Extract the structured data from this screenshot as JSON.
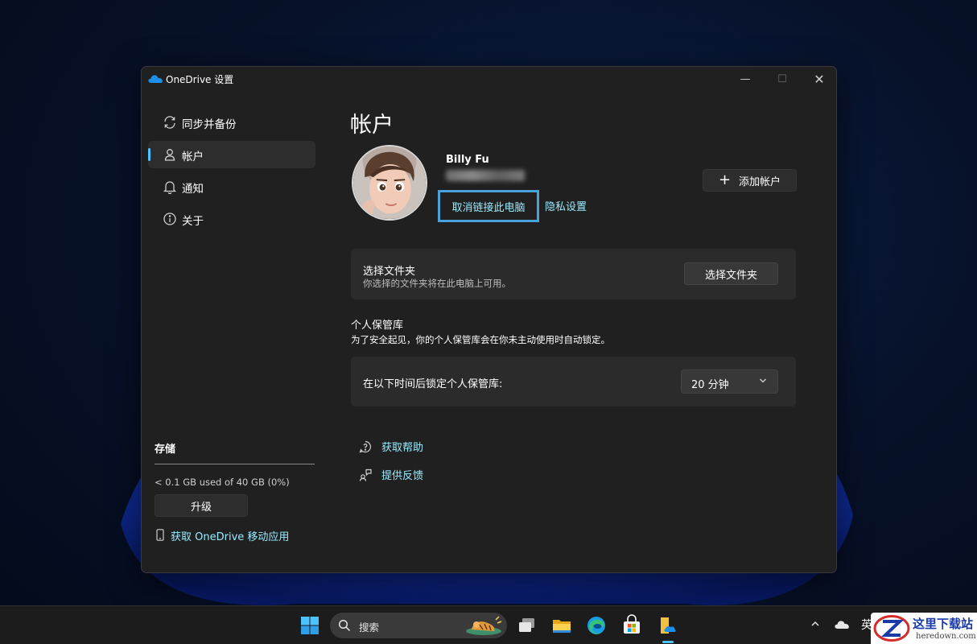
{
  "window": {
    "title": "OneDrive 设置",
    "minimize_glyph": "—",
    "maximize_glyph": "☐",
    "close_glyph": "✕"
  },
  "sidebar": {
    "items": [
      {
        "label": "同步并备份",
        "icon": "sync-icon",
        "selected": false
      },
      {
        "label": "帐户",
        "icon": "person-icon",
        "selected": true
      },
      {
        "label": "通知",
        "icon": "bell-icon",
        "selected": false
      },
      {
        "label": "关于",
        "icon": "info-icon",
        "selected": false
      }
    ],
    "storage": {
      "title": "存储",
      "usage": "< 0.1 GB used of 40 GB (0%)",
      "upgrade_label": "升级",
      "mobile_link": "获取 OneDrive 移动应用"
    }
  },
  "main": {
    "page_title": "帐户",
    "account": {
      "name": "Billy Fu",
      "email": "",
      "unlink_label": "取消链接此电脑",
      "privacy_label": "隐私设置",
      "add_account_label": "添加帐户"
    },
    "choose_folders": {
      "title": "选择文件夹",
      "description": "你选择的文件夹将在此电脑上可用。",
      "button_label": "选择文件夹"
    },
    "personal_vault": {
      "title": "个人保管库",
      "description": "为了安全起见，你的个人保管库会在你未主动使用时自动锁定。",
      "lock_label": "在以下时间后锁定个人保管库:",
      "lock_value": "20 分钟"
    },
    "help_links": {
      "help": "获取帮助",
      "feedback": "提供反馈"
    }
  },
  "taskbar": {
    "search_placeholder": "搜索",
    "language_indicator": "英",
    "accent_color": "#4cc2ff"
  },
  "watermark": {
    "title": "这里下载站",
    "subtitle": "heredown.com"
  },
  "colors": {
    "link": "#99ebff",
    "accent": "#4cc2ff",
    "window_bg": "#202020",
    "card_bg": "#2b2b2b"
  }
}
